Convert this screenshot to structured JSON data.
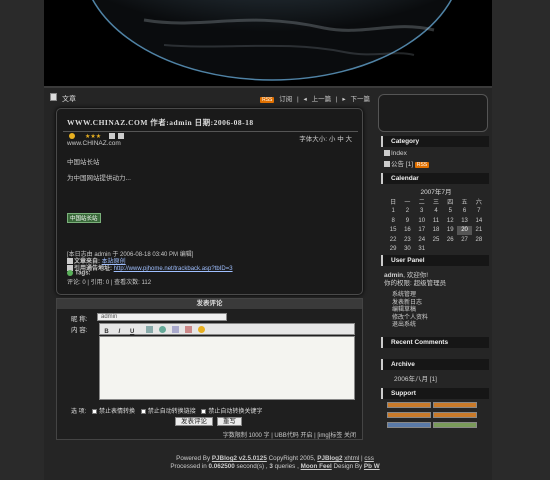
{
  "postbar": {
    "crumb": "文章",
    "subscribe": "订阅",
    "prev": "上一篇",
    "next": "下一篇",
    "rss_badge": "RSS"
  },
  "article": {
    "title": "WWW.CHINAZ.COM",
    "meta": "作者:admin 日期:2006-08-18",
    "font_size_label": "字体大小:",
    "font_sizes": [
      "小",
      "中",
      "大"
    ],
    "site": "www.CHINAZ.com",
    "body1": "中国站长站",
    "body2": "为中国网站提供动力...",
    "image_badge": "中国站长站",
    "signature": "[本日志由 admin 于 2006-08-18 03:40 PM 编辑]",
    "from_label": "文章来自:",
    "from_value": "本站原创",
    "trackback_label": "引用通告地址:",
    "trackback_url": "http://www.pjhome.net/trackback.asp?tbID=3",
    "tags_label": "Tags:",
    "stats": "评论: 0 | 引用: 0 | 查看次数: 112"
  },
  "comment": {
    "header": "发表评论",
    "nick_label": "昵 称:",
    "nick_value": "admin",
    "content_label": "内 容:",
    "options_label": "选 项:",
    "opt1": "禁止表情转换",
    "opt2": "禁止自动转换链接",
    "opt3": "禁止自动转换关键字",
    "submit": "发表评论",
    "reset": "重写",
    "limits": "字数限制 1000 字 | UBB代码 开启 | [img]标签 关闭"
  },
  "sidebar": {
    "category_title": "Category",
    "cat_index": "Index",
    "cat_notice": "公告 [1]",
    "calendar_title": "Calendar",
    "cal_month": "2007年7月",
    "weekdays": [
      "日",
      "一",
      "二",
      "三",
      "四",
      "五",
      "六"
    ],
    "weeks": [
      [
        "1",
        "2",
        "3",
        "4",
        "5",
        "6",
        "7"
      ],
      [
        "8",
        "9",
        "10",
        "11",
        "12",
        "13",
        "14"
      ],
      [
        "15",
        "16",
        "17",
        "18",
        "19",
        "20",
        "21"
      ],
      [
        "22",
        "23",
        "24",
        "25",
        "26",
        "27",
        "28"
      ],
      [
        "29",
        "30",
        "31",
        "",
        "",
        "",
        ""
      ]
    ],
    "today": "20",
    "userpanel_title": "User Panel",
    "welcome_user": "admin",
    "welcome_text": ", 欢迎你!",
    "role": "你的权限: 超级管理员",
    "links": [
      "系统管理",
      "发表新日志",
      "编辑草稿",
      "修改个人资料",
      "退出系统"
    ],
    "recent_title": "Recent Comments",
    "archive_title": "Archive",
    "archive_item": "2006年八月 [1]",
    "support_title": "Support"
  },
  "footer": {
    "line1_a": "Powered By",
    "line1_b": "PJBlog2 v2.5.0125",
    "line1_c": "CopyRight 2005,",
    "line1_d": "PJBlog2",
    "line1_e": "xhtml",
    "line1_f": "css",
    "line2_a": "Processed in",
    "line2_b": "0.062500",
    "line2_c": "second(s) ,",
    "line2_d": "3",
    "line2_e": "queries ,",
    "line2_f": "Moon Feel",
    "line2_g": "Design By",
    "line2_h": "Pb W"
  }
}
